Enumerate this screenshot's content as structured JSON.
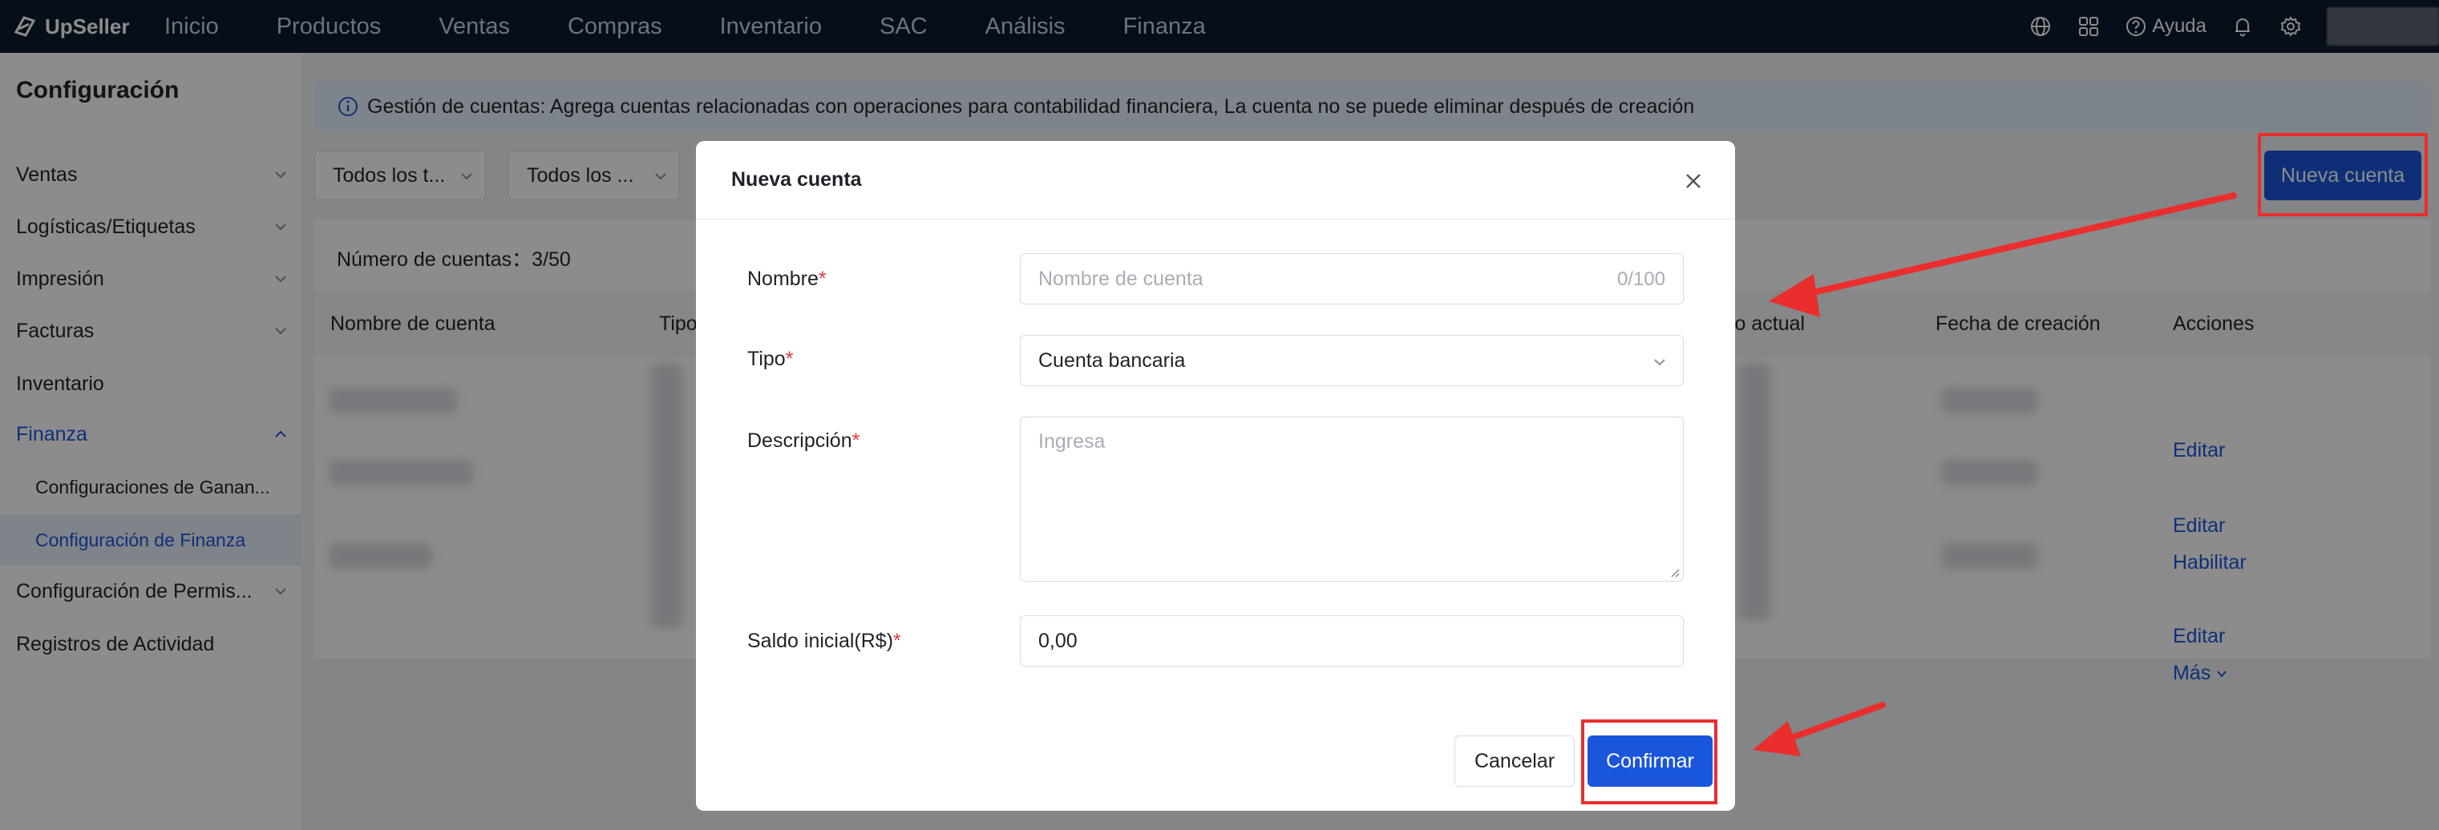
{
  "brand": {
    "name": "UpSeller"
  },
  "nav": {
    "items": [
      "Inicio",
      "Productos",
      "Ventas",
      "Compras",
      "Inventario",
      "SAC",
      "Análisis",
      "Finanza"
    ],
    "help_label": "Ayuda"
  },
  "sidebar": {
    "title": "Configuración",
    "items": [
      {
        "label": "Ventas"
      },
      {
        "label": "Logísticas/Etiquetas"
      },
      {
        "label": "Impresión"
      },
      {
        "label": "Facturas"
      },
      {
        "label": "Inventario"
      },
      {
        "label": "Finanza"
      },
      {
        "label": "Configuraciones de Ganan..."
      },
      {
        "label": "Configuración de Finanza"
      },
      {
        "label": "Configuración de Permis..."
      },
      {
        "label": "Registros de Actividad"
      }
    ]
  },
  "main": {
    "banner": "Gestión de cuentas: Agrega cuentas relacionadas con operaciones para contabilidad financiera, La cuenta no se puede eliminar después de creación",
    "filters": [
      "Todos los t...",
      "Todos los ..."
    ],
    "new_account_label": "Nueva cuenta",
    "count_label": "Número de cuentas：3/50",
    "columns": [
      "Nombre de cuenta",
      "Tipo",
      "lo actual",
      "Fecha de creación",
      "Acciones"
    ],
    "actions": {
      "edit": "Editar",
      "enable": "Habilitar",
      "more": "Más"
    }
  },
  "modal": {
    "title": "Nueva cuenta",
    "name_label": "Nombre",
    "name_placeholder": "Nombre de cuenta",
    "name_counter": "0/100",
    "type_label": "Tipo",
    "type_value": "Cuenta bancaria",
    "desc_label": "Descripción",
    "desc_placeholder": "Ingresa",
    "balance_label": "Saldo inicial(R$)",
    "balance_value": "0,00",
    "required_mark": "*",
    "cancel_label": "Cancelar",
    "confirm_label": "Confirmar"
  },
  "colors": {
    "nav_bg": "#0a1a2e",
    "primary": "#1a56db",
    "annotation": "#ea2e2e",
    "banner_bg": "#e6f0ff"
  }
}
